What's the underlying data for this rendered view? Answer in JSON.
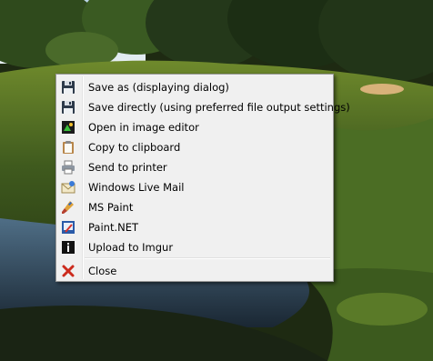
{
  "menu": {
    "items": [
      {
        "label": "Save as (displaying dialog)",
        "icon": "floppy-disk-icon"
      },
      {
        "label": "Save directly (using preferred file output settings)",
        "icon": "floppy-disk-icon"
      },
      {
        "label": "Open in image editor",
        "icon": "image-editor-icon"
      },
      {
        "label": "Copy to clipboard",
        "icon": "clipboard-icon"
      },
      {
        "label": "Send to printer",
        "icon": "printer-icon"
      },
      {
        "label": "Windows Live Mail",
        "icon": "mail-icon"
      },
      {
        "label": "MS Paint",
        "icon": "paint-brush-icon"
      },
      {
        "label": "Paint.NET",
        "icon": "paintnet-icon"
      },
      {
        "label": "Upload to Imgur",
        "icon": "imgur-icon"
      }
    ],
    "close": {
      "label": "Close",
      "icon": "red-x-icon"
    }
  },
  "colors": {
    "menu_background": "#f0f0f0",
    "menu_border": "#979797",
    "close_icon": "#cc2b1d"
  }
}
